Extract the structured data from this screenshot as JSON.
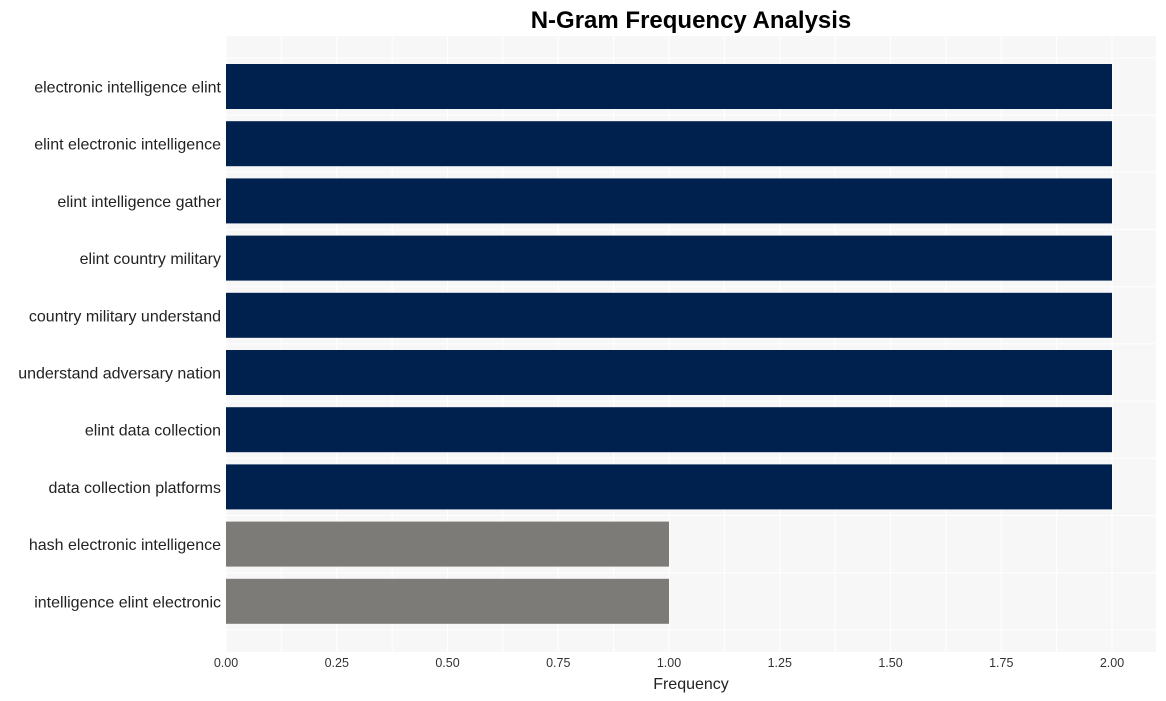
{
  "chart_data": {
    "type": "bar",
    "orientation": "horizontal",
    "title": "N-Gram Frequency Analysis",
    "xlabel": "Frequency",
    "ylabel": "",
    "xlim": [
      0,
      2.1
    ],
    "xticks": [
      "0.00",
      "0.25",
      "0.50",
      "0.75",
      "1.00",
      "1.25",
      "1.50",
      "1.75",
      "2.00"
    ],
    "xtick_values": [
      0,
      0.25,
      0.5,
      0.75,
      1.0,
      1.25,
      1.5,
      1.75,
      2.0
    ],
    "grid": true,
    "categories": [
      "electronic intelligence elint",
      "elint electronic intelligence",
      "elint intelligence gather",
      "elint country military",
      "country military understand",
      "understand adversary nation",
      "elint data collection",
      "data collection platforms",
      "hash electronic intelligence",
      "intelligence elint electronic"
    ],
    "values": [
      2,
      2,
      2,
      2,
      2,
      2,
      2,
      2,
      1,
      1
    ],
    "colors": {
      "high": "#00214e",
      "low": "#7c7b77",
      "plot_background": "#f7f7f7",
      "grid": "#ffffff"
    }
  }
}
